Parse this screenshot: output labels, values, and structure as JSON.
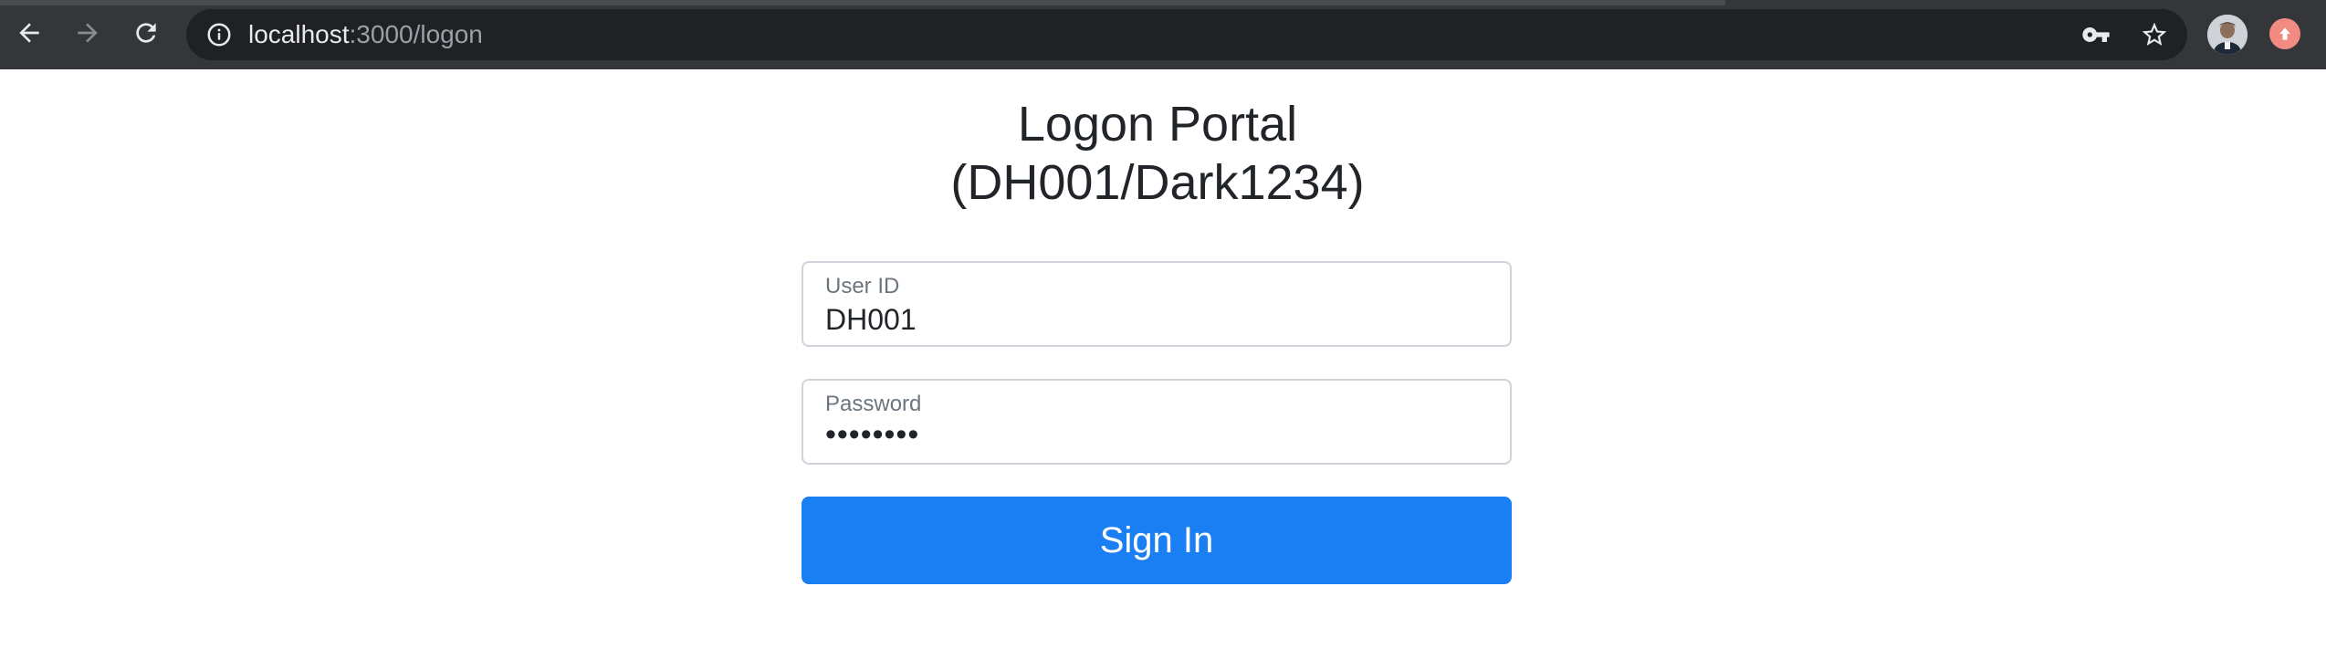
{
  "browser": {
    "url_host": "localhost",
    "url_path": ":3000/logon",
    "icons": {
      "back": "back-arrow-icon",
      "forward": "forward-arrow-icon",
      "reload": "reload-icon",
      "site_info": "info-icon",
      "password_key": "key-icon",
      "bookmark": "star-icon",
      "profile": "avatar",
      "update": "update-arrow-icon"
    }
  },
  "page": {
    "title_line1": "Logon Portal",
    "title_line2": "(DH001/Dark1234)",
    "user_id": {
      "label": "User ID",
      "value": "DH001"
    },
    "password": {
      "label": "Password",
      "value": "••••••••"
    },
    "submit_label": "Sign In"
  },
  "colors": {
    "chrome_bg": "#35363a",
    "omnibox_bg": "#202124",
    "primary": "#1a7ff2",
    "text": "#212529",
    "label": "#6c757d",
    "border": "#ced4da"
  }
}
